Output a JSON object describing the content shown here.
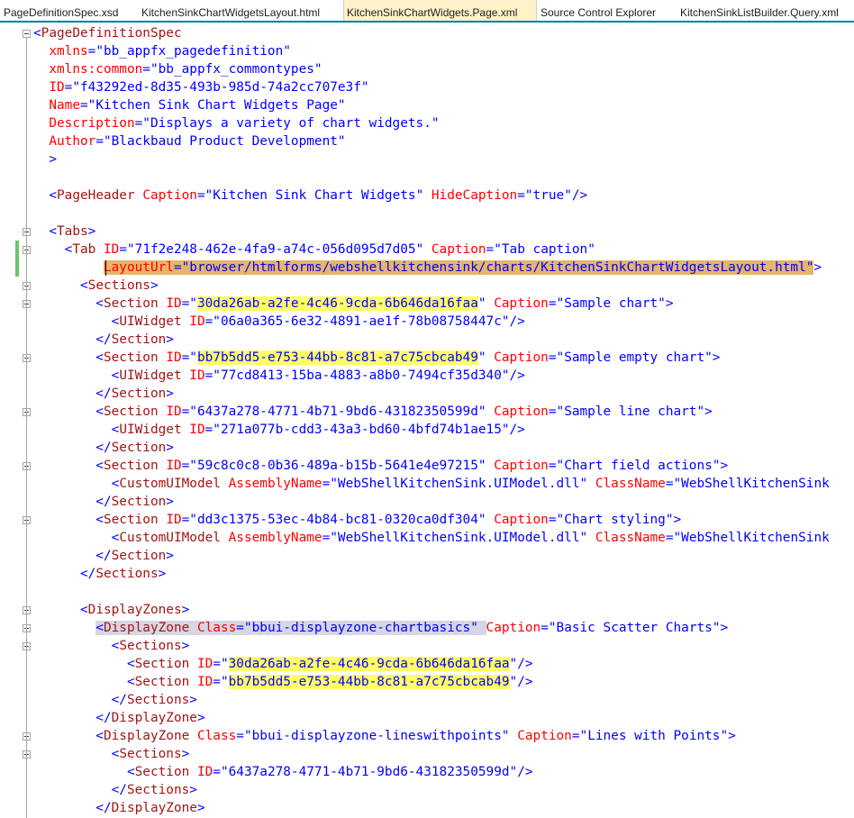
{
  "tabs": [
    {
      "label": "PageDefinitionSpec.xsd",
      "active": false
    },
    {
      "label": "KitchenSinkChartWidgetsLayout.html",
      "active": false
    },
    {
      "label": "KitchenSinkChartWidgets.Page.xml",
      "active": true
    },
    {
      "label": "Source Control Explorer",
      "active": false
    },
    {
      "label": "KitchenSinkListBuilder.Query.xml",
      "active": false
    }
  ],
  "lines": [
    [
      {
        "c": "b",
        "t": "<"
      },
      {
        "c": "t",
        "t": "PageDefinitionSpec"
      }
    ],
    [
      {
        "c": "b",
        "t": "  "
      },
      {
        "c": "a",
        "t": "xmlns"
      },
      {
        "c": "b",
        "t": "=\""
      },
      {
        "c": "v",
        "t": "bb_appfx_pagedefinition"
      },
      {
        "c": "b",
        "t": "\""
      }
    ],
    [
      {
        "c": "b",
        "t": "  "
      },
      {
        "c": "a",
        "t": "xmlns:common"
      },
      {
        "c": "b",
        "t": "=\""
      },
      {
        "c": "v",
        "t": "bb_appfx_commontypes"
      },
      {
        "c": "b",
        "t": "\""
      }
    ],
    [
      {
        "c": "b",
        "t": "  "
      },
      {
        "c": "a",
        "t": "ID"
      },
      {
        "c": "b",
        "t": "=\""
      },
      {
        "c": "v",
        "t": "f43292ed-8d35-493b-985d-74a2cc707e3f"
      },
      {
        "c": "b",
        "t": "\""
      }
    ],
    [
      {
        "c": "b",
        "t": "  "
      },
      {
        "c": "a",
        "t": "Name"
      },
      {
        "c": "b",
        "t": "=\""
      },
      {
        "c": "v",
        "t": "Kitchen Sink Chart Widgets Page"
      },
      {
        "c": "b",
        "t": "\""
      }
    ],
    [
      {
        "c": "b",
        "t": "  "
      },
      {
        "c": "a",
        "t": "Description"
      },
      {
        "c": "b",
        "t": "=\""
      },
      {
        "c": "v",
        "t": "Displays a variety of chart widgets."
      },
      {
        "c": "b",
        "t": "\""
      }
    ],
    [
      {
        "c": "b",
        "t": "  "
      },
      {
        "c": "a",
        "t": "Author"
      },
      {
        "c": "b",
        "t": "=\""
      },
      {
        "c": "v",
        "t": "Blackbaud Product Development"
      },
      {
        "c": "b",
        "t": "\""
      }
    ],
    [
      {
        "c": "b",
        "t": "  >"
      }
    ],
    [],
    [
      {
        "c": "b",
        "t": "  <"
      },
      {
        "c": "t",
        "t": "PageHeader"
      },
      {
        "c": "b",
        "t": " "
      },
      {
        "c": "a",
        "t": "Caption"
      },
      {
        "c": "b",
        "t": "=\""
      },
      {
        "c": "v",
        "t": "Kitchen Sink Chart Widgets"
      },
      {
        "c": "b",
        "t": "\" "
      },
      {
        "c": "a",
        "t": "HideCaption"
      },
      {
        "c": "b",
        "t": "=\""
      },
      {
        "c": "v",
        "t": "true"
      },
      {
        "c": "b",
        "t": "\"/>"
      }
    ],
    [],
    [
      {
        "c": "b",
        "t": "  <"
      },
      {
        "c": "t",
        "t": "Tabs"
      },
      {
        "c": "b",
        "t": ">"
      }
    ],
    [
      {
        "c": "b",
        "t": "    <"
      },
      {
        "c": "t",
        "t": "Tab"
      },
      {
        "c": "b",
        "t": " "
      },
      {
        "c": "a",
        "t": "ID"
      },
      {
        "c": "b",
        "t": "=\""
      },
      {
        "c": "v",
        "t": "71f2e248-462e-4fa9-a74c-056d095d7d05"
      },
      {
        "c": "b",
        "t": "\" "
      },
      {
        "c": "a",
        "t": "Caption"
      },
      {
        "c": "b",
        "t": "=\""
      },
      {
        "c": "v",
        "t": "Tab caption"
      },
      {
        "c": "b",
        "t": "\""
      }
    ],
    [
      {
        "c": "b",
        "t": "         "
      },
      {
        "c": "a",
        "t": "LayoutUrl",
        "h": "o"
      },
      {
        "c": "b",
        "t": "=\"",
        "h": "o"
      },
      {
        "c": "v",
        "t": "browser/htmlforms/webshellkitchensink/charts/KitchenSinkChartWidgetsLayout.html",
        "h": "o"
      },
      {
        "c": "b",
        "t": "\"",
        "h": "o"
      },
      {
        "c": "b",
        "t": ">"
      }
    ],
    [
      {
        "c": "b",
        "t": "      <"
      },
      {
        "c": "t",
        "t": "Sections"
      },
      {
        "c": "b",
        "t": ">"
      }
    ],
    [
      {
        "c": "b",
        "t": "        <"
      },
      {
        "c": "t",
        "t": "Section"
      },
      {
        "c": "b",
        "t": " "
      },
      {
        "c": "a",
        "t": "ID"
      },
      {
        "c": "b",
        "t": "=\""
      },
      {
        "c": "v",
        "t": "30da26ab-a2fe-4c46-9cda-6b646da16faa",
        "h": "y"
      },
      {
        "c": "b",
        "t": "\" "
      },
      {
        "c": "a",
        "t": "Caption"
      },
      {
        "c": "b",
        "t": "=\""
      },
      {
        "c": "v",
        "t": "Sample chart"
      },
      {
        "c": "b",
        "t": "\">"
      }
    ],
    [
      {
        "c": "b",
        "t": "          <"
      },
      {
        "c": "t",
        "t": "UIWidget"
      },
      {
        "c": "b",
        "t": " "
      },
      {
        "c": "a",
        "t": "ID"
      },
      {
        "c": "b",
        "t": "=\""
      },
      {
        "c": "v",
        "t": "06a0a365-6e32-4891-ae1f-78b08758447c"
      },
      {
        "c": "b",
        "t": "\"/>"
      }
    ],
    [
      {
        "c": "b",
        "t": "        </"
      },
      {
        "c": "t",
        "t": "Section"
      },
      {
        "c": "b",
        "t": ">"
      }
    ],
    [
      {
        "c": "b",
        "t": "        <"
      },
      {
        "c": "t",
        "t": "Section"
      },
      {
        "c": "b",
        "t": " "
      },
      {
        "c": "a",
        "t": "ID"
      },
      {
        "c": "b",
        "t": "=\""
      },
      {
        "c": "v",
        "t": "bb7b5dd5-e753-44bb-8c81-a7c75cbcab49",
        "h": "y"
      },
      {
        "c": "b",
        "t": "\" "
      },
      {
        "c": "a",
        "t": "Caption"
      },
      {
        "c": "b",
        "t": "=\""
      },
      {
        "c": "v",
        "t": "Sample empty chart"
      },
      {
        "c": "b",
        "t": "\">"
      }
    ],
    [
      {
        "c": "b",
        "t": "          <"
      },
      {
        "c": "t",
        "t": "UIWidget"
      },
      {
        "c": "b",
        "t": " "
      },
      {
        "c": "a",
        "t": "ID"
      },
      {
        "c": "b",
        "t": "=\""
      },
      {
        "c": "v",
        "t": "77cd8413-15ba-4883-a8b0-7494cf35d340"
      },
      {
        "c": "b",
        "t": "\"/>"
      }
    ],
    [
      {
        "c": "b",
        "t": "        </"
      },
      {
        "c": "t",
        "t": "Section"
      },
      {
        "c": "b",
        "t": ">"
      }
    ],
    [
      {
        "c": "b",
        "t": "        <"
      },
      {
        "c": "t",
        "t": "Section"
      },
      {
        "c": "b",
        "t": " "
      },
      {
        "c": "a",
        "t": "ID"
      },
      {
        "c": "b",
        "t": "=\""
      },
      {
        "c": "v",
        "t": "6437a278-4771-4b71-9bd6-43182350599d"
      },
      {
        "c": "b",
        "t": "\" "
      },
      {
        "c": "a",
        "t": "Caption"
      },
      {
        "c": "b",
        "t": "=\""
      },
      {
        "c": "v",
        "t": "Sample line chart"
      },
      {
        "c": "b",
        "t": "\">"
      }
    ],
    [
      {
        "c": "b",
        "t": "          <"
      },
      {
        "c": "t",
        "t": "UIWidget"
      },
      {
        "c": "b",
        "t": " "
      },
      {
        "c": "a",
        "t": "ID"
      },
      {
        "c": "b",
        "t": "=\""
      },
      {
        "c": "v",
        "t": "271a077b-cdd3-43a3-bd60-4bfd74b1ae15"
      },
      {
        "c": "b",
        "t": "\"/>"
      }
    ],
    [
      {
        "c": "b",
        "t": "        </"
      },
      {
        "c": "t",
        "t": "Section"
      },
      {
        "c": "b",
        "t": ">"
      }
    ],
    [
      {
        "c": "b",
        "t": "        <"
      },
      {
        "c": "t",
        "t": "Section"
      },
      {
        "c": "b",
        "t": " "
      },
      {
        "c": "a",
        "t": "ID"
      },
      {
        "c": "b",
        "t": "=\""
      },
      {
        "c": "v",
        "t": "59c8c0c8-0b36-489a-b15b-5641e4e97215"
      },
      {
        "c": "b",
        "t": "\" "
      },
      {
        "c": "a",
        "t": "Caption"
      },
      {
        "c": "b",
        "t": "=\""
      },
      {
        "c": "v",
        "t": "Chart field actions"
      },
      {
        "c": "b",
        "t": "\">"
      }
    ],
    [
      {
        "c": "b",
        "t": "          <"
      },
      {
        "c": "t",
        "t": "CustomUIModel"
      },
      {
        "c": "b",
        "t": " "
      },
      {
        "c": "a",
        "t": "AssemblyName"
      },
      {
        "c": "b",
        "t": "=\""
      },
      {
        "c": "v",
        "t": "WebShellKitchenSink.UIModel.dll"
      },
      {
        "c": "b",
        "t": "\" "
      },
      {
        "c": "a",
        "t": "ClassName"
      },
      {
        "c": "b",
        "t": "=\""
      },
      {
        "c": "v",
        "t": "WebShellKitchenSink"
      }
    ],
    [
      {
        "c": "b",
        "t": "        </"
      },
      {
        "c": "t",
        "t": "Section"
      },
      {
        "c": "b",
        "t": ">"
      }
    ],
    [
      {
        "c": "b",
        "t": "        <"
      },
      {
        "c": "t",
        "t": "Section"
      },
      {
        "c": "b",
        "t": " "
      },
      {
        "c": "a",
        "t": "ID"
      },
      {
        "c": "b",
        "t": "=\""
      },
      {
        "c": "v",
        "t": "dd3c1375-53ec-4b84-bc81-0320ca0df304"
      },
      {
        "c": "b",
        "t": "\" "
      },
      {
        "c": "a",
        "t": "Caption"
      },
      {
        "c": "b",
        "t": "=\""
      },
      {
        "c": "v",
        "t": "Chart styling"
      },
      {
        "c": "b",
        "t": "\">"
      }
    ],
    [
      {
        "c": "b",
        "t": "          <"
      },
      {
        "c": "t",
        "t": "CustomUIModel"
      },
      {
        "c": "b",
        "t": " "
      },
      {
        "c": "a",
        "t": "AssemblyName"
      },
      {
        "c": "b",
        "t": "=\""
      },
      {
        "c": "v",
        "t": "WebShellKitchenSink.UIModel.dll"
      },
      {
        "c": "b",
        "t": "\" "
      },
      {
        "c": "a",
        "t": "ClassName"
      },
      {
        "c": "b",
        "t": "=\""
      },
      {
        "c": "v",
        "t": "WebShellKitchenSink"
      }
    ],
    [
      {
        "c": "b",
        "t": "        </"
      },
      {
        "c": "t",
        "t": "Section"
      },
      {
        "c": "b",
        "t": ">"
      }
    ],
    [
      {
        "c": "b",
        "t": "      </"
      },
      {
        "c": "t",
        "t": "Sections"
      },
      {
        "c": "b",
        "t": ">"
      }
    ],
    [],
    [
      {
        "c": "b",
        "t": "      <"
      },
      {
        "c": "t",
        "t": "DisplayZones"
      },
      {
        "c": "b",
        "t": ">"
      }
    ],
    [
      {
        "c": "b",
        "t": "        "
      },
      {
        "c": "b",
        "t": "<",
        "h": "g"
      },
      {
        "c": "t",
        "t": "DisplayZone",
        "h": "g"
      },
      {
        "c": "b",
        "t": " ",
        "h": "g"
      },
      {
        "c": "a",
        "t": "Class",
        "h": "g"
      },
      {
        "c": "b",
        "t": "=\"",
        "h": "g"
      },
      {
        "c": "v",
        "t": "bbui-displayzone-chartbasics",
        "h": "g"
      },
      {
        "c": "b",
        "t": "\" ",
        "h": "g"
      },
      {
        "c": "a",
        "t": "Caption"
      },
      {
        "c": "b",
        "t": "=\""
      },
      {
        "c": "v",
        "t": "Basic Scatter Charts"
      },
      {
        "c": "b",
        "t": "\">"
      }
    ],
    [
      {
        "c": "b",
        "t": "          <"
      },
      {
        "c": "t",
        "t": "Sections"
      },
      {
        "c": "b",
        "t": ">"
      }
    ],
    [
      {
        "c": "b",
        "t": "            <"
      },
      {
        "c": "t",
        "t": "Section"
      },
      {
        "c": "b",
        "t": " "
      },
      {
        "c": "a",
        "t": "ID"
      },
      {
        "c": "b",
        "t": "=\""
      },
      {
        "c": "v",
        "t": "30da26ab-a2fe-4c46-9cda-6b646da16faa",
        "h": "y"
      },
      {
        "c": "b",
        "t": "\"/>"
      }
    ],
    [
      {
        "c": "b",
        "t": "            <"
      },
      {
        "c": "t",
        "t": "Section"
      },
      {
        "c": "b",
        "t": " "
      },
      {
        "c": "a",
        "t": "ID"
      },
      {
        "c": "b",
        "t": "=\""
      },
      {
        "c": "v",
        "t": "bb7b5dd5-e753-44bb-8c81-a7c75cbcab49",
        "h": "y"
      },
      {
        "c": "b",
        "t": "\"/>"
      }
    ],
    [
      {
        "c": "b",
        "t": "          </"
      },
      {
        "c": "t",
        "t": "Sections"
      },
      {
        "c": "b",
        "t": ">"
      }
    ],
    [
      {
        "c": "b",
        "t": "        </"
      },
      {
        "c": "t",
        "t": "DisplayZone"
      },
      {
        "c": "b",
        "t": ">"
      }
    ],
    [
      {
        "c": "b",
        "t": "        <"
      },
      {
        "c": "t",
        "t": "DisplayZone"
      },
      {
        "c": "b",
        "t": " "
      },
      {
        "c": "a",
        "t": "Class"
      },
      {
        "c": "b",
        "t": "=\""
      },
      {
        "c": "v",
        "t": "bbui-displayzone-lineswithpoints"
      },
      {
        "c": "b",
        "t": "\" "
      },
      {
        "c": "a",
        "t": "Caption"
      },
      {
        "c": "b",
        "t": "=\""
      },
      {
        "c": "v",
        "t": "Lines with Points"
      },
      {
        "c": "b",
        "t": "\">"
      }
    ],
    [
      {
        "c": "b",
        "t": "          <"
      },
      {
        "c": "t",
        "t": "Sections"
      },
      {
        "c": "b",
        "t": ">"
      }
    ],
    [
      {
        "c": "b",
        "t": "            <"
      },
      {
        "c": "t",
        "t": "Section"
      },
      {
        "c": "b",
        "t": " "
      },
      {
        "c": "a",
        "t": "ID"
      },
      {
        "c": "b",
        "t": "=\""
      },
      {
        "c": "v",
        "t": "6437a278-4771-4b71-9bd6-43182350599d"
      },
      {
        "c": "b",
        "t": "\"/>"
      }
    ],
    [
      {
        "c": "b",
        "t": "          </"
      },
      {
        "c": "t",
        "t": "Sections"
      },
      {
        "c": "b",
        "t": ">"
      }
    ],
    [
      {
        "c": "b",
        "t": "        </"
      },
      {
        "c": "t",
        "t": "DisplayZone"
      },
      {
        "c": "b",
        "t": ">"
      }
    ]
  ],
  "colors": {
    "bracket": "#0000ff",
    "tag": "#a31515",
    "attribute": "#ff0000",
    "value": "#0000ff",
    "highlight_match": "#ffff66",
    "highlight_selection": "#e5b56a",
    "highlight_tag": "#d6d6e4",
    "change_marker": "#6ac46a",
    "active_tab": "#fff2c8"
  }
}
